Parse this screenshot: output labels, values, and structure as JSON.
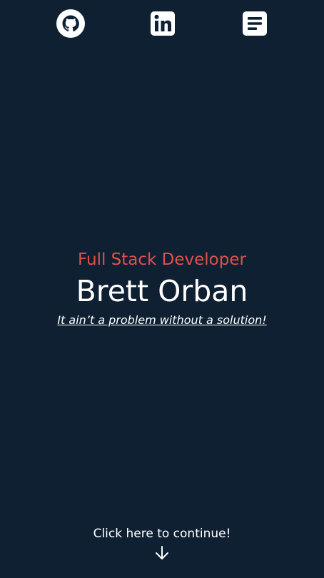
{
  "nav": {
    "items": [
      {
        "icon": "github-icon"
      },
      {
        "icon": "linkedin-icon"
      },
      {
        "icon": "document-icon"
      }
    ]
  },
  "hero": {
    "subtitle": "Full Stack Developer",
    "name": "Brett Orban",
    "tagline": "It ain’t a problem without a solution!"
  },
  "footer": {
    "continue_label": "Click here to continue!",
    "arrow_icon": "arrow-down-icon"
  },
  "colors": {
    "background": "#0f2033",
    "accent": "#e0504b",
    "text": "#ffffff"
  }
}
